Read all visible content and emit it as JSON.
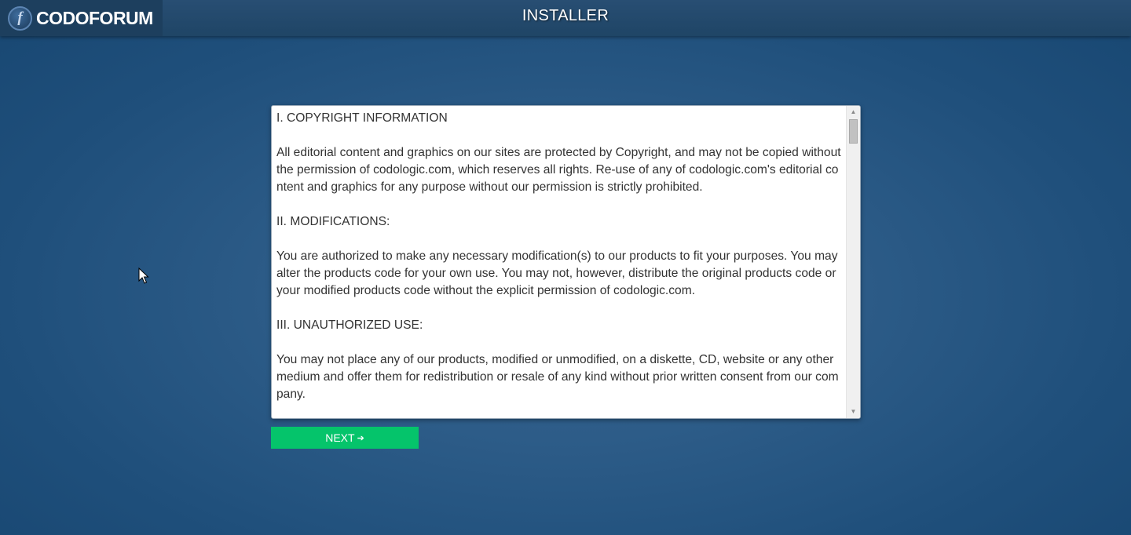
{
  "app": {
    "logo_letter": "f",
    "brand": "CODOFORUM",
    "title": "INSTALLER"
  },
  "license": {
    "sections": [
      "I. COPYRIGHT INFORMATION",
      "All editorial content and graphics on our sites are protected by Copyright, and may not be copied without the permission of codologic.com, which reserves all rights. Re-use of any of codologic.com's editorial content and graphics for any purpose without our permission is strictly prohibited.",
      "II. MODIFICATIONS:",
      "You are authorized to make any necessary modification(s) to our products to fit your purposes. You may alter the products code for your own use. You may not, however, distribute the original products code or your modified products code without the explicit permission of codologic.com.",
      "III. UNAUTHORIZED USE:",
      "You may not place any of our products, modified or unmodified, on a diskette, CD, website or any other medium and offer them for redistribution or resale of any kind without prior written consent from our company."
    ]
  },
  "actions": {
    "next_label": "NEXT",
    "next_icon": "arrow-right-icon"
  },
  "colors": {
    "accent_button": "#05c46b",
    "header_bg": "#1f4566",
    "page_bg": "#2d5c88"
  }
}
